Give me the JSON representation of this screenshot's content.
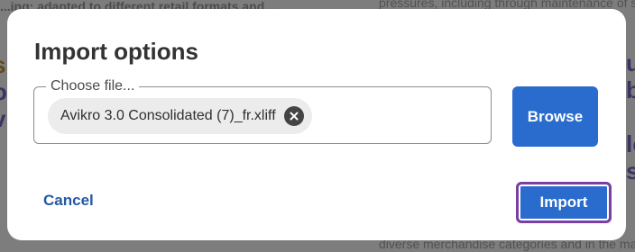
{
  "background": {
    "lines": [
      "...ing; adapted to different retail formats and...",
      "pressures, including through maintenance of su...",
      "diverse merchandise categories and in the ma..."
    ]
  },
  "dialog": {
    "title": "Import options",
    "file_field": {
      "legend": "Choose file...",
      "selected_file": "Avikro 3.0 Consolidated (7)_fr.xliff",
      "remove_icon": "close-circle-icon"
    },
    "browse_label": "Browse",
    "cancel_label": "Cancel",
    "import_label": "Import"
  },
  "colors": {
    "primary": "#2a6ccd",
    "focus_ring": "#7a3fa5",
    "overlay": "#7d7d7d"
  }
}
